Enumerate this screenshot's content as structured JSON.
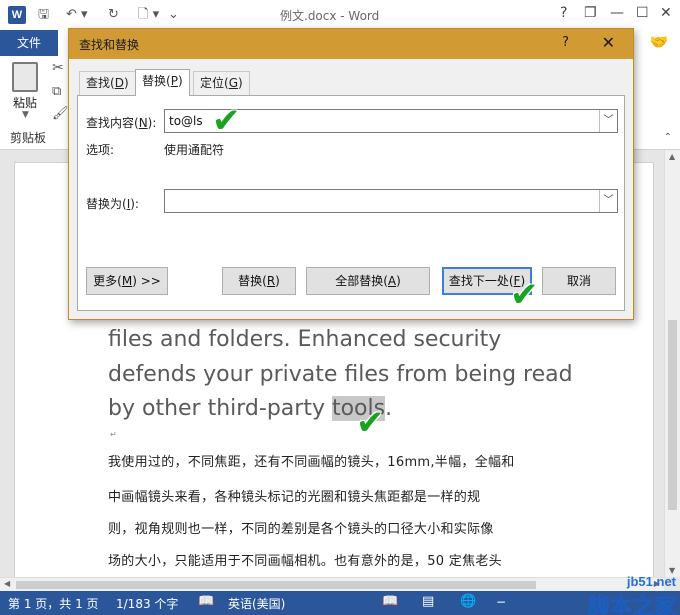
{
  "app": {
    "title": "例文.docx - Word",
    "logo_letter": "W",
    "quick_access": {
      "save_icon": "save-icon",
      "undo_icon": "undo-icon",
      "redo_icon": "redo-icon",
      "print_preview_icon": "print-preview-icon"
    },
    "window_controls": {
      "help": "?",
      "restore": "❐",
      "minimize": "—",
      "maximize": "☐",
      "close": "✕"
    }
  },
  "ribbon": {
    "file_tab": "文件",
    "paste_label": "粘贴",
    "clipboard_group": "剪贴板"
  },
  "dialog": {
    "title": "查找和替换",
    "help": "?",
    "close": "✕",
    "tabs": [
      {
        "label": "查找(",
        "key": "D",
        "suffix": ")"
      },
      {
        "label": "替换(",
        "key": "P",
        "suffix": ")"
      },
      {
        "label": "定位(",
        "key": "G",
        "suffix": ")"
      }
    ],
    "find_label": {
      "pre": "查找内容(",
      "key": "N",
      "post": "):"
    },
    "find_value": "to@ls",
    "options_label": "选项:",
    "options_value": "使用通配符",
    "replace_label": {
      "pre": "替换为(",
      "key": "I",
      "post": "):"
    },
    "replace_value": "",
    "buttons": {
      "more": {
        "pre": "更多(",
        "key": "M",
        "post": ") >>"
      },
      "replace": {
        "pre": "替换(",
        "key": "R",
        "post": ")"
      },
      "replace_all": {
        "pre": "全部替换(",
        "key": "A",
        "post": ")"
      },
      "find_next": {
        "pre": "查找下一处(",
        "key": "F",
        "post": ")"
      },
      "cancel": "取消"
    }
  },
  "document": {
    "english_lines": [
      "files and folders. Enhanced security",
      "defends your private files from being read"
    ],
    "line3_pre": "by other third-party ",
    "line3_hl": "tools",
    "line3_post": ".",
    "chinese_lines": [
      "我使用过的，不同焦距，还有不同画幅的镜头，16mm,半幅，全幅和",
      "中画幅镜头来看，各种镜头标记的光圈和镜头焦距都是一样的规",
      "则，视角规则也一样，不同的差别是各个镜头的口径大小和实际像",
      "场的大小，只能适用于不同画幅相机。也有意外的是，50 定焦老头"
    ]
  },
  "statusbar": {
    "page": "第 1 页，共 1 页",
    "words": "1/183 个字",
    "language": "英语(美国)"
  },
  "watermark": {
    "url": "jb51.net",
    "name": "脚本之家"
  },
  "checkmark": "✔"
}
